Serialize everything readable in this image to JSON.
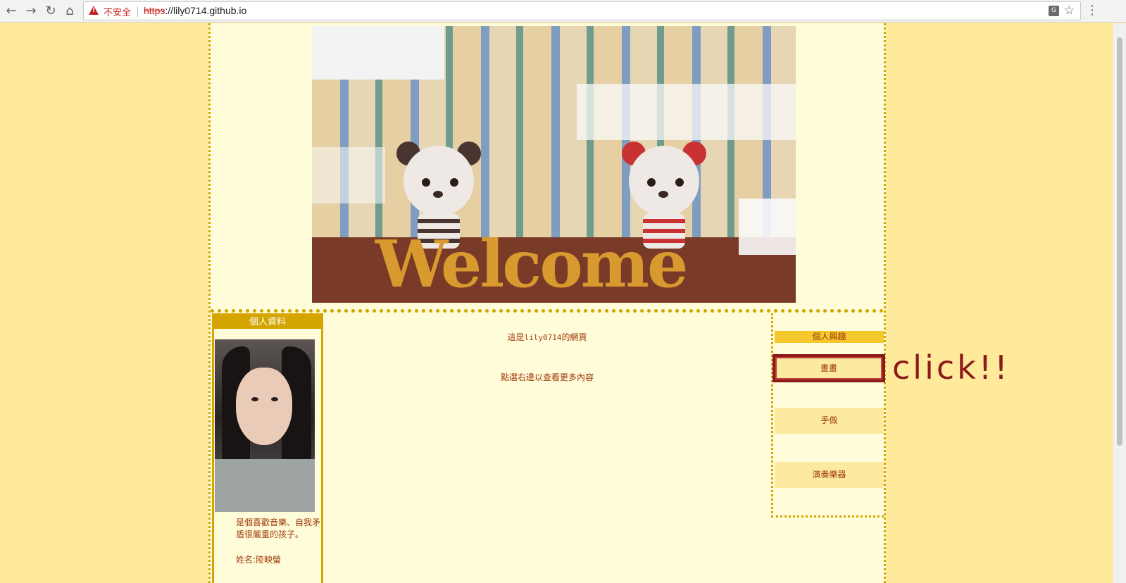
{
  "browser": {
    "security_label": "不安全",
    "url_scheme": "https",
    "url_rest": "://lily0714.github.io"
  },
  "banner": {
    "welcome_text": "Welcome"
  },
  "profile": {
    "header": "個人資料",
    "bio": "是個喜歡音樂、自我矛盾很嚴重的孩子。",
    "name": "姓名:陸映螢"
  },
  "main": {
    "intro_prefix": "這是",
    "intro_user": "lily0714",
    "intro_suffix": "的網頁",
    "hint": "點選右邊以查看更多內容"
  },
  "interests": {
    "header": "個人興趣",
    "items": [
      {
        "label": "畫畫"
      },
      {
        "label": "手做"
      },
      {
        "label": "演奏樂器"
      }
    ]
  },
  "annotation": {
    "text": "click!!"
  }
}
